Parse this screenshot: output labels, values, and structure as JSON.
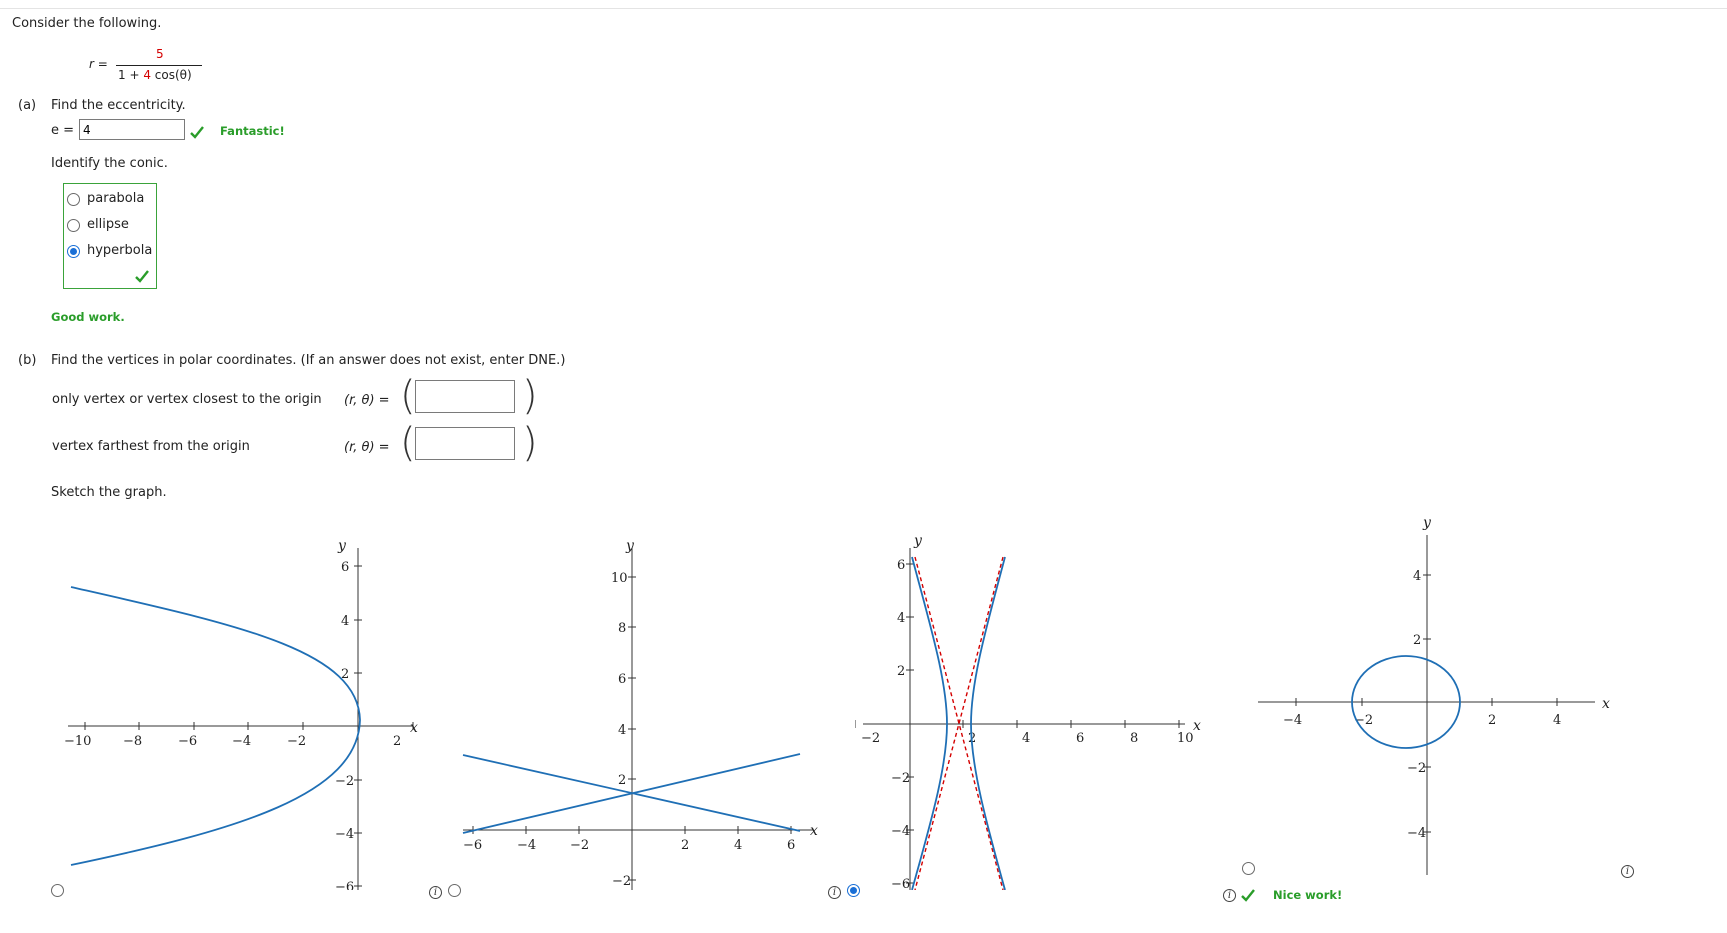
{
  "intro": "Consider the following.",
  "equation": {
    "lhs": "r =",
    "numerator": "5",
    "denominator_pre": "1 + ",
    "denominator_coef": "4",
    "denominator_post": " cos(θ)"
  },
  "part_a": {
    "label": "(a)",
    "prompt": "Find the eccentricity.",
    "e_label": "e =",
    "e_value": "4",
    "feedback": "Fantastic!",
    "identify": "Identify the conic.",
    "options": [
      "parabola",
      "ellipse",
      "hyperbola"
    ],
    "selected": "hyperbola",
    "feedback2": "Good work."
  },
  "part_b": {
    "label": "(b)",
    "prompt": "Find the vertices in polar coordinates. (If an answer does not exist, enter DNE.)",
    "vertex1_label": "only vertex or vertex closest to the origin",
    "vertex2_label": "vertex farthest from the origin",
    "coord_label": "(r, θ) =",
    "vertex1_value": "",
    "vertex2_value": "",
    "sketch": "Sketch the graph.",
    "feedback": "Nice work!",
    "selected_graph": 3
  },
  "icons": [
    "check-icon",
    "info-icon",
    "radio-icon"
  ],
  "colors": {
    "curve": "#1f6fb5",
    "asymptote": "#d40000",
    "correct": "#2a9d2a",
    "selected": "#1a6fd6"
  },
  "graphs": [
    {
      "xticks": [
        "−10",
        "−8",
        "−6",
        "−4",
        "−2",
        "2"
      ],
      "yticks": [
        "6",
        "4",
        "2",
        "−2",
        "−4",
        "−6"
      ],
      "xlabel": "x",
      "ylabel": "y"
    },
    {
      "xticks": [
        "−6",
        "−4",
        "−2",
        "2",
        "4",
        "6"
      ],
      "yticks": [
        "10",
        "8",
        "6",
        "4",
        "2",
        "−2"
      ],
      "xlabel": "x",
      "ylabel": "y"
    },
    {
      "xticks": [
        "−2",
        "2",
        "4",
        "6",
        "8",
        "10"
      ],
      "yticks": [
        "6",
        "4",
        "2",
        "−2",
        "−4",
        "−6"
      ],
      "xlabel": "x",
      "ylabel": "y"
    },
    {
      "xticks": [
        "−4",
        "−2",
        "2",
        "4"
      ],
      "yticks": [
        "4",
        "2",
        "−2",
        "−4"
      ],
      "xlabel": "x",
      "ylabel": "y"
    }
  ]
}
